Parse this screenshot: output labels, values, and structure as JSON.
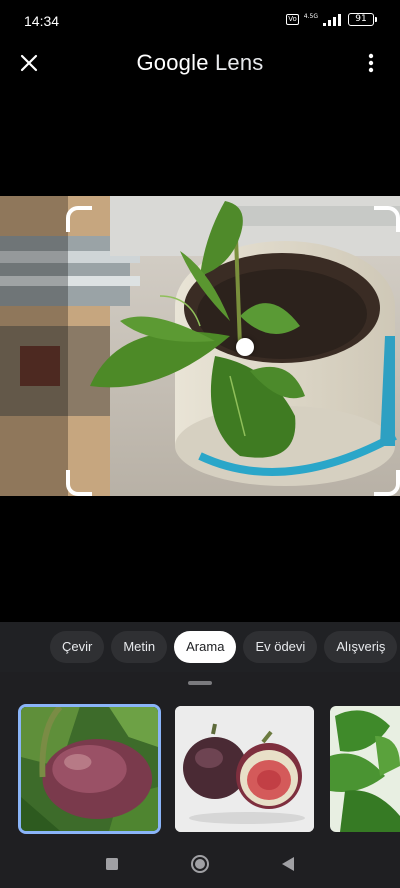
{
  "status_bar": {
    "time": "14:34",
    "volte": "VoLTE",
    "network": "4.5G",
    "battery": "91"
  },
  "app_bar": {
    "title_brand": "Google",
    "title_product": "Lens",
    "close_icon": "close-icon",
    "menu_icon": "more-vert-icon"
  },
  "modes": [
    {
      "label": "Çevir",
      "active": false
    },
    {
      "label": "Metin",
      "active": false
    },
    {
      "label": "Arama",
      "active": true
    },
    {
      "label": "Ev ödevi",
      "active": false
    },
    {
      "label": "Alışveriş",
      "active": false
    }
  ],
  "results": [
    {
      "subject": "purple fig on branch",
      "selected": true
    },
    {
      "subject": "two figs, one halved",
      "selected": false
    },
    {
      "subject": "fig leaves",
      "selected": false
    }
  ],
  "colors": {
    "accent": "#8ab4f8",
    "sheet_bg": "#1f1f22",
    "chip_bg": "#2f3033",
    "chip_active_bg": "#ffffff"
  },
  "nav": {
    "recent": "square-icon",
    "home": "circle-icon",
    "back": "triangle-back-icon"
  }
}
